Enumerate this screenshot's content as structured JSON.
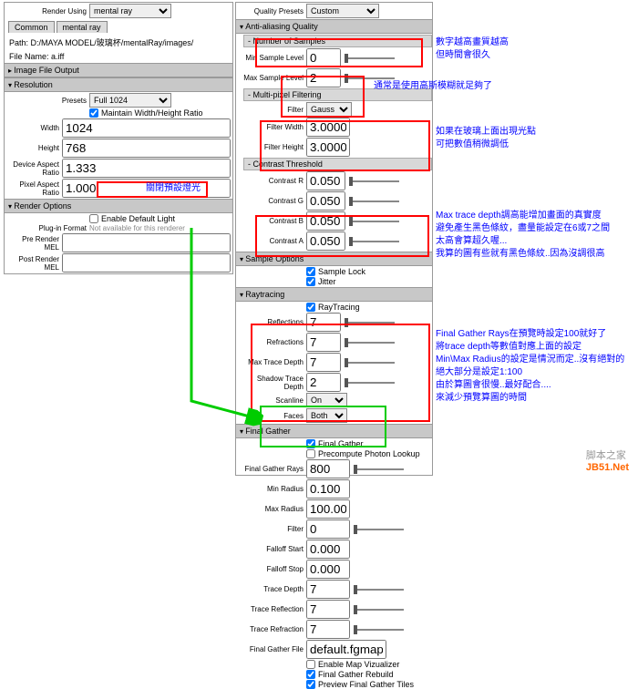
{
  "top": {
    "renderUsingLbl": "Render Using",
    "renderUsing": "mental ray"
  },
  "tabs": {
    "common": "Common",
    "mentalray": "mental ray"
  },
  "path": {
    "label": "Path: D:/MAYA MODEL/玻璃杯/mentalRay/images/",
    "file": "File Name:   a.iff"
  },
  "sections": {
    "ifo": "Image File Output",
    "res": "Resolution",
    "ro": "Render Options"
  },
  "res": {
    "presets": "Presets",
    "presetsVal": "Full 1024",
    "maintain": "Maintain Width/Height Ratio",
    "width": "Width",
    "widthVal": "1024",
    "height": "Height",
    "heightVal": "768",
    "dar": "Device Aspect Ratio",
    "darVal": "1.333",
    "par": "Pixel Aspect Ratio",
    "parVal": "1.000"
  },
  "ro": {
    "edl": "Enable Default Light",
    "plugin": "Plug-in Format",
    "pre": "Pre Render MEL",
    "post": "Post Render MEL",
    "note": "關閉預設燈光"
  },
  "qp": {
    "label": "Quality Presets",
    "val": "Custom"
  },
  "aa": {
    "title": "Anti-aliasing Quality",
    "nos": "Number of Samples",
    "min": "Min Sample Level",
    "minVal": "0",
    "max": "Max Sample Level",
    "maxVal": "2",
    "mpf": "Multi-pixel Filtering",
    "filter": "Filter",
    "filterVal": "Gauss",
    "fw": "Filter Width",
    "fwVal": "3.0000",
    "fh": "Filter Height",
    "fhVal": "3.0000",
    "ct": "Contrast Threshold",
    "cr": "Contrast R",
    "cg": "Contrast G",
    "cb": "Contrast B",
    "ca": "Contrast A",
    "cVal": "0.050"
  },
  "so": {
    "title": "Sample Options",
    "sl": "Sample Lock",
    "jit": "Jitter"
  },
  "rt": {
    "title": "Raytracing",
    "rtc": "RayTracing",
    "refl": "Reflections",
    "refr": "Refractions",
    "mtd": "Max Trace Depth",
    "val": "7",
    "std": "Shadow Trace Depth",
    "stdVal": "2",
    "scan": "Scanline",
    "scanVal": "On",
    "faces": "Faces",
    "facesVal": "Both"
  },
  "fg": {
    "title": "Final Gather",
    "fgc": "Final Gather",
    "ppl": "Precompute Photon Lookup",
    "rays": "Final Gather Rays",
    "raysVal": "800",
    "minr": "Min Radius",
    "minrVal": "0.100",
    "maxr": "Max Radius",
    "maxrVal": "100.000",
    "filter": "Filter",
    "filterVal": "0",
    "fs": "Falloff Start",
    "fsVal": "0.000",
    "fe": "Falloff Stop",
    "feVal": "0.000",
    "td": "Trace Depth",
    "trefl": "Trace Reflection",
    "trefr": "Trace Refraction",
    "tVal": "7",
    "fgf": "Final Gather File",
    "fgfVal": "default.fgmap",
    "emv": "Enable Map Vizualizer",
    "fgr": "Final Gather Rebuild",
    "pfgt": "Preview Final Gather Tiles"
  },
  "notes": {
    "n1a": "數字越高畫質越高",
    "n1b": "但時間會很久",
    "n2": "通常是使用高斯模糊就足夠了",
    "n3a": "如果在玻璃上面出現光點",
    "n3b": "可把數值稍微調低",
    "n4a": "Max trace depth調高能增加畫面的真實度",
    "n4b": "避免產生黑色條紋，盡量能設定在6或7之間",
    "n4c": "太高會算超久喔...",
    "n4d": "我算的圖有些就有黑色條紋..因為沒調很高",
    "n5a": "Final Gather Rays在預覽時設定100就好了",
    "n5b": "將trace depth等數值對應上面的設定",
    "n5c": "Min\\Max Radius的設定是情況而定..沒有絕對的",
    "n5d": "絕大部分是設定1:100",
    "n5e": "由於算圖會很慢..最好配合....",
    "n5f": "來減少預覽算圖的時間"
  },
  "wm": {
    "a": "脚本之家",
    "b": "JB51.Net"
  }
}
